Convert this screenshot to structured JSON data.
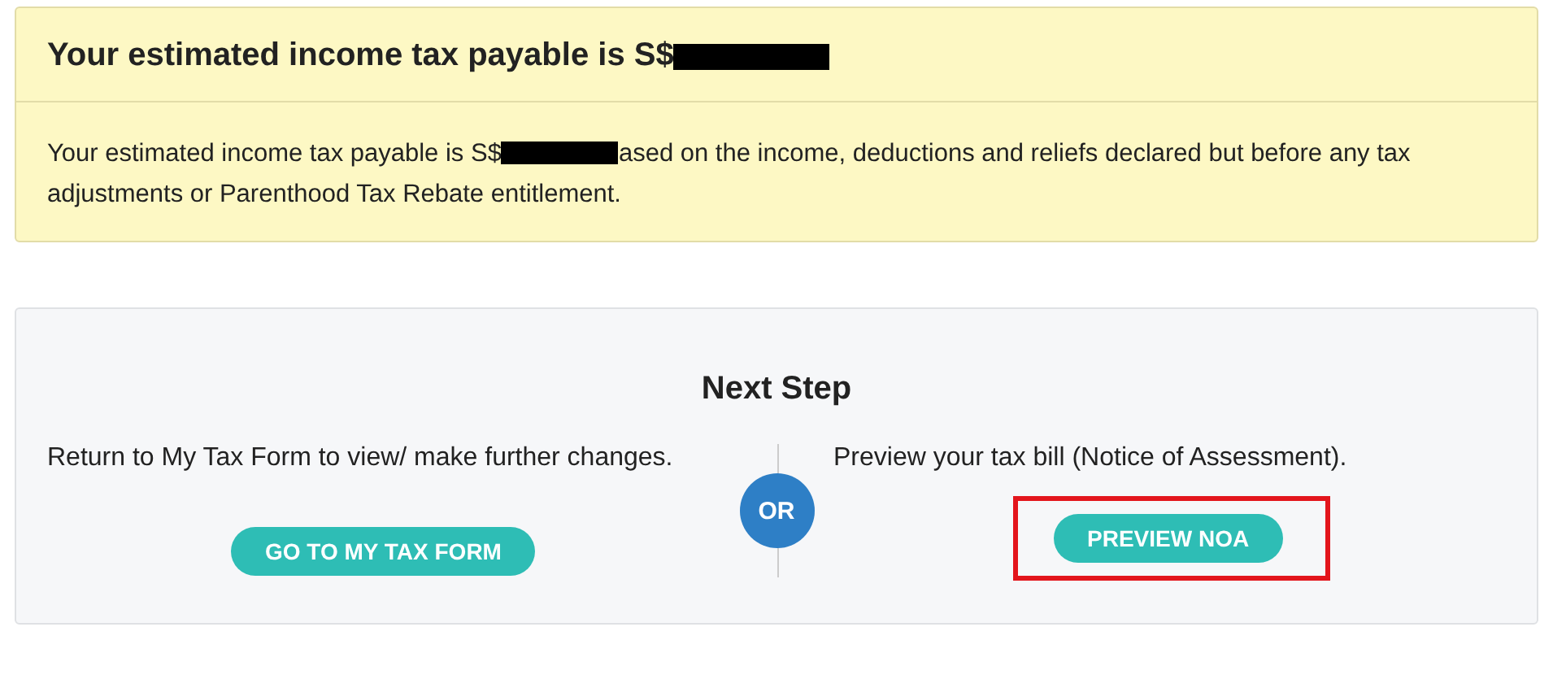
{
  "estimate_panel": {
    "heading": "Your estimated income tax payable is S$",
    "body_before": "Your estimated income tax payable is S$",
    "body_after": "ased on the income, deductions and reliefs declared but before any tax adjustments or Parenthood Tax Rebate entitlement."
  },
  "next_step": {
    "title": "Next Step",
    "options": [
      {
        "text": "Return to My Tax Form to view/ make further changes.",
        "button": "GO TO MY TAX FORM",
        "highlighted": false
      },
      {
        "text": "Preview your tax bill (Notice of Assessment).",
        "button": "PREVIEW NOA",
        "highlighted": true
      }
    ],
    "divider_label": "OR"
  }
}
